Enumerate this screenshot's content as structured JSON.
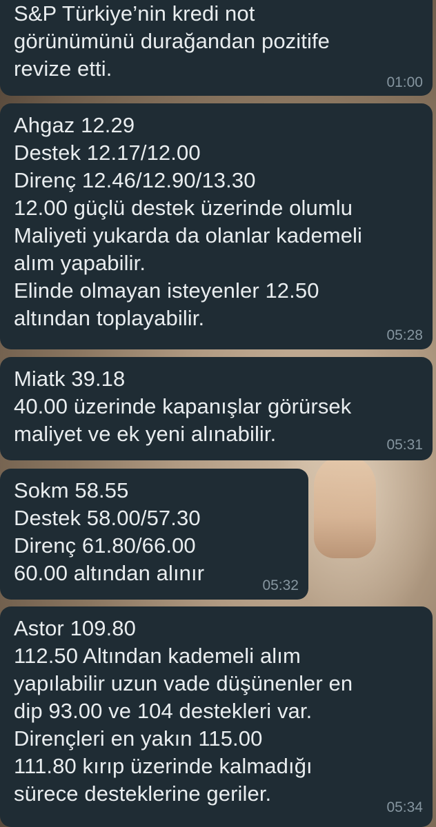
{
  "messages": [
    {
      "text": "S&P Türkiye’nin kredi not\ngörünümünü durağandan pozitife\nrevize etti.",
      "time": "01:00"
    },
    {
      "text": "Ahgaz 12.29\nDestek 12.17/12.00\nDirenç 12.46/12.90/13.30\n12.00 güçlü destek üzerinde olumlu\nMaliyeti yukarda da olanlar kademeli\nalım yapabilir.\nElinde olmayan isteyenler 12.50\naltından toplayabilir.",
      "time": "05:28"
    },
    {
      "text": "Miatk 39.18\n40.00 üzerinde kapanışlar görürsek\nmaliyet ve ek yeni alınabilir.",
      "time": "05:31"
    },
    {
      "text": "Sokm 58.55\nDestek 58.00/57.30\nDirenç 61.80/66.00\n60.00 altından alınır",
      "time": "05:32"
    },
    {
      "text": "Astor 109.80\n112.50 Altından kademeli alım\nyapılabilir uzun vade düşünenler en\ndip 93.00 ve 104 destekleri var.\nDirençleri en yakın 115.00\n111.80 kırıp üzerinde kalmadığı\nsürece desteklerine geriler.",
      "time": "05:34"
    }
  ],
  "colors": {
    "bubble_background": "#1f2c34",
    "message_text": "#e9edef",
    "timestamp": "#8696a0"
  }
}
